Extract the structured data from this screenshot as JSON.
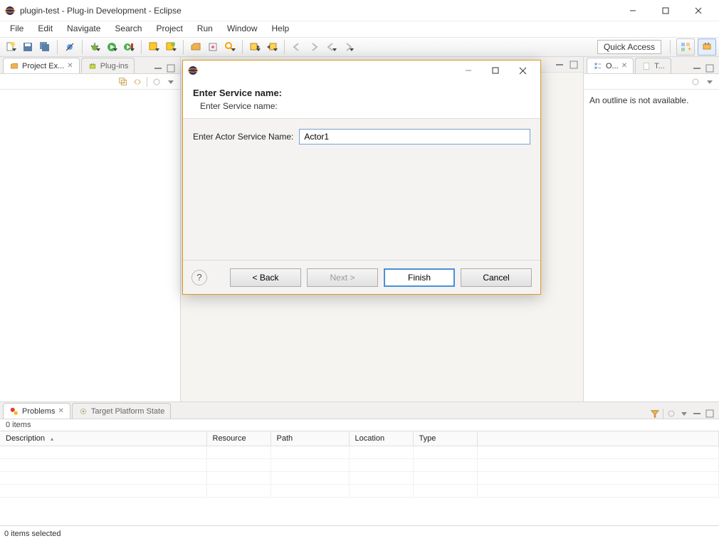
{
  "window": {
    "title": "plugin-test - Plug-in Development - Eclipse"
  },
  "menu": [
    "File",
    "Edit",
    "Navigate",
    "Search",
    "Project",
    "Run",
    "Window",
    "Help"
  ],
  "toolbar": {
    "quick_access": "Quick Access"
  },
  "left": {
    "tabs": [
      {
        "label": "Project Ex...",
        "active": true
      },
      {
        "label": "Plug-ins",
        "active": false
      }
    ]
  },
  "right": {
    "tabs": [
      {
        "label": "O...",
        "active": true
      },
      {
        "label": "T...",
        "active": false
      }
    ],
    "empty_text": "An outline is not available."
  },
  "bottom": {
    "tabs": [
      {
        "label": "Problems",
        "active": true
      },
      {
        "label": "Target Platform State",
        "active": false
      }
    ],
    "count": "0 items",
    "columns": [
      "Description",
      "Resource",
      "Path",
      "Location",
      "Type"
    ]
  },
  "status": "0 items selected",
  "dialog": {
    "banner_title": "Enter Service name:",
    "banner_sub": "Enter Service name:",
    "field_label": "Enter Actor Service Name:",
    "field_value": "Actor1",
    "buttons": {
      "back": "< Back",
      "next": "Next >",
      "finish": "Finish",
      "cancel": "Cancel"
    }
  }
}
